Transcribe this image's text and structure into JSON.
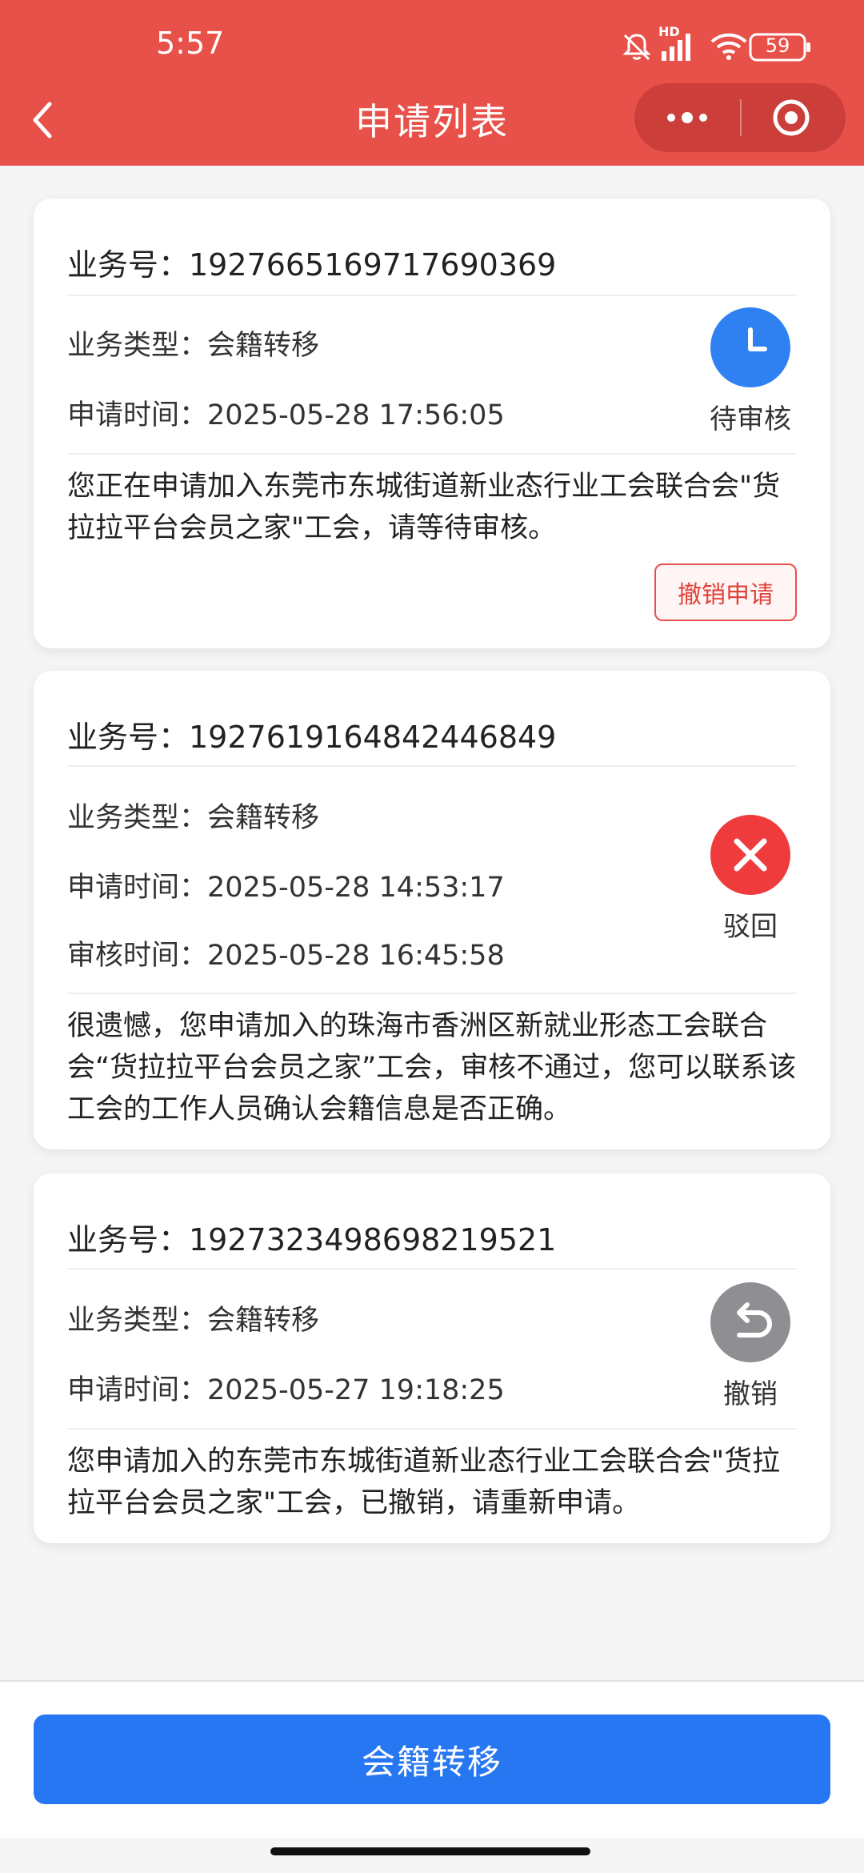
{
  "status_bar": {
    "time": "5:57",
    "battery": "59",
    "network": "HD"
  },
  "nav": {
    "title": "申请列表"
  },
  "cards": [
    {
      "biz_no": "业务号：1927665169717690369",
      "type": "业务类型：会籍转移",
      "apply_time": "申请时间：2025-05-28 17:56:05",
      "status": "待审核",
      "message": "您正在申请加入东莞市东城街道新业态行业工会联合会\"货拉拉平台会员之家\"工会，请等待审核。",
      "action": "撤销申请"
    },
    {
      "biz_no": "业务号：1927619164842446849",
      "type": "业务类型：会籍转移",
      "apply_time": "申请时间：2025-05-28 14:53:17",
      "review_time": "审核时间：2025-05-28 16:45:58",
      "status": "驳回",
      "message": "很遗憾，您申请加入的珠海市香洲区新就业形态工会联合会“货拉拉平台会员之家”工会，审核不通过，您可以联系该工会的工作人员确认会籍信息是否正确。"
    },
    {
      "biz_no": "业务号：1927323498698219521",
      "type": "业务类型：会籍转移",
      "apply_time": "申请时间：2025-05-27 19:18:25",
      "status": "撤销",
      "message": "您申请加入的东莞市东城街道新业态行业工会联合会\"货拉拉平台会员之家\"工会，已撤销，请重新申请。"
    }
  ],
  "bottom": {
    "button": "会籍转移"
  },
  "colors": {
    "header": "#e8504a",
    "pending": "#2f80f0",
    "rejected": "#ef3b3b",
    "revoked": "#8e8e93",
    "primary": "#2877f2"
  }
}
